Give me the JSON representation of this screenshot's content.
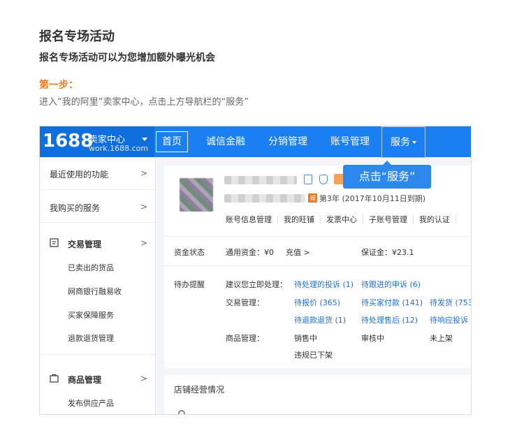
{
  "page": {
    "title": "报名专场活动",
    "subtitle": "报名专场活动可以为您增加额外曝光机会",
    "step_label": "第一步：",
    "step_text": "进入“我的阿里”卖家中心，点击上方导航栏的“服务”"
  },
  "topnav": {
    "logo_num": "1688",
    "logo_name": "卖家中心",
    "logo_url": "work.1688.com",
    "items": [
      "首页",
      "诚信金融",
      "分销管理",
      "账号管理",
      "服务"
    ]
  },
  "callout": "点击“服务”",
  "sidebar": {
    "items": [
      "最近使用的功能",
      "我购买的服务"
    ],
    "section1": {
      "label": "交易管理",
      "subs": [
        "已卖出的货品",
        "网商银行融易收",
        "买家保障服务",
        "退款退货管理"
      ]
    },
    "section2": {
      "label": "商品管理",
      "subs": [
        "发布供应产品"
      ]
    },
    "chevron": ">"
  },
  "account": {
    "vip": "诚",
    "years": "第3年 (2017年10月11日到期)",
    "links": [
      "账号信息管理",
      "我的旺铺",
      "发票中心",
      "子账号管理",
      "我的认证"
    ]
  },
  "funds": {
    "label": "资金状态",
    "balance": "通用资金：¥0",
    "recharge": "充值 >",
    "deposit": "保证金：¥23.1"
  },
  "todo": {
    "label": "待办提醒",
    "suggest_label": "建议您立即处理：",
    "suggest_items": [
      "待处理的投诉 (1)",
      "待跟进的申诉 (6)"
    ],
    "trade_label": "交易管理：",
    "trade_items": [
      "待报价 (365)",
      "待买家付款 (141)",
      "待发货 (753",
      "待退款退货 (1)",
      "待处理售后 (12)",
      "待响应投诉 ("
    ],
    "goods_label": "商品管理：",
    "goods_items": [
      "销售中",
      "审核中",
      "未上架",
      "违规已下架"
    ]
  },
  "panel2": {
    "title": "店铺经营情况"
  },
  "colors": {
    "nav_blue": "#1a7ff0",
    "accent_orange": "#f07a1e",
    "link_blue": "#1f6fd6"
  }
}
